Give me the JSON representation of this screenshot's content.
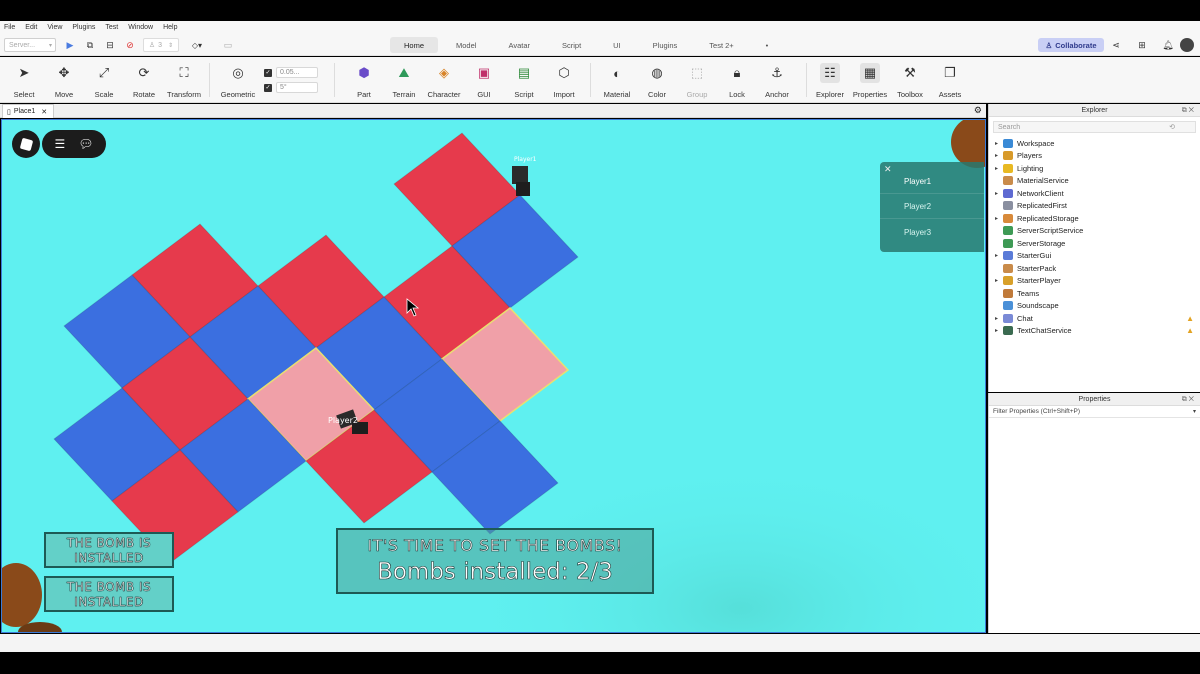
{
  "menu": [
    "File",
    "Edit",
    "View",
    "Plugins",
    "Test",
    "Window",
    "Help"
  ],
  "quick": {
    "server_select": "Server...",
    "players_count": "3"
  },
  "tabs": [
    "Home",
    "Model",
    "Avatar",
    "Script",
    "UI",
    "Plugins",
    "Test 2+"
  ],
  "active_tab": "Home",
  "collaborate_label": "Collaborate",
  "tools": {
    "select": "Select",
    "move": "Move",
    "scale": "Scale",
    "rotate": "Rotate",
    "transform": "Transform",
    "geometric": "Geometric",
    "part": "Part",
    "terrain": "Terrain",
    "character": "Character",
    "gui": "GUI",
    "script": "Script",
    "import": "Import",
    "material": "Material",
    "color": "Color",
    "group": "Group",
    "lock": "Lock",
    "anchor": "Anchor",
    "explorer": "Explorer",
    "properties": "Properties",
    "toolbox": "Toolbox",
    "assets": "Assets"
  },
  "snap": {
    "move_value": "0.05...",
    "rotate_value": "5°"
  },
  "doc_tab": "Place1",
  "game": {
    "player_list": [
      "Player1",
      "Player2",
      "Player3"
    ],
    "label_player1": "Player1",
    "label_player2": "Player2",
    "bomb_status_1": "THE BOMB IS INSTALLED",
    "bomb_status_2": "THE BOMB IS INSTALLED",
    "message_line1": "IT'S TIME TO SET THE BOMBS!",
    "message_line2": "Bombs installed: 2/3"
  },
  "explorer": {
    "title": "Explorer",
    "search_placeholder": "Search",
    "items": [
      {
        "label": "Workspace",
        "expandable": true,
        "icon_color": "#3a8ad6",
        "icon": "workspace-icon"
      },
      {
        "label": "Players",
        "expandable": true,
        "icon_color": "#d89a2a",
        "icon": "players-icon"
      },
      {
        "label": "Lighting",
        "expandable": true,
        "icon_color": "#e8b923",
        "icon": "lighting-icon"
      },
      {
        "label": "MaterialService",
        "expandable": false,
        "icon_color": "#c98b4a",
        "icon": "material-service-icon"
      },
      {
        "label": "NetworkClient",
        "expandable": true,
        "icon_color": "#5e6ad2",
        "icon": "network-icon"
      },
      {
        "label": "ReplicatedFirst",
        "expandable": false,
        "icon_color": "#8a8fa0",
        "icon": "replicated-first-icon"
      },
      {
        "label": "ReplicatedStorage",
        "expandable": true,
        "icon_color": "#d88a3a",
        "icon": "replicated-storage-icon"
      },
      {
        "label": "ServerScriptService",
        "expandable": false,
        "icon_color": "#3e9a55",
        "icon": "server-script-icon"
      },
      {
        "label": "ServerStorage",
        "expandable": false,
        "icon_color": "#3e9a55",
        "icon": "server-storage-icon"
      },
      {
        "label": "StarterGui",
        "expandable": true,
        "icon_color": "#5a7bd8",
        "icon": "starter-gui-icon"
      },
      {
        "label": "StarterPack",
        "expandable": false,
        "icon_color": "#c98b4a",
        "icon": "starter-pack-icon"
      },
      {
        "label": "StarterPlayer",
        "expandable": true,
        "icon_color": "#d8a02a",
        "icon": "starter-player-icon"
      },
      {
        "label": "Teams",
        "expandable": false,
        "icon_color": "#c07a3a",
        "icon": "teams-icon"
      },
      {
        "label": "Soundscape",
        "expandable": false,
        "icon_color": "#4a90d8",
        "icon": "soundscape-icon"
      },
      {
        "label": "Chat",
        "expandable": true,
        "icon_color": "#7a8ad6",
        "icon": "chat-icon",
        "warning": true
      },
      {
        "label": "TextChatService",
        "expandable": true,
        "icon_color": "#3a6a50",
        "icon": "text-chat-icon",
        "warning": true
      }
    ]
  },
  "properties": {
    "title": "Properties",
    "filter_placeholder": "Filter Properties (Ctrl+Shift+P)"
  },
  "colors": {
    "viewport_bg": "#5ff0f0",
    "tile_red": "#e63a4c",
    "tile_blue": "#3b6fe0",
    "tile_pink": "#f0a0a8",
    "accent": "#2f3a8c"
  }
}
